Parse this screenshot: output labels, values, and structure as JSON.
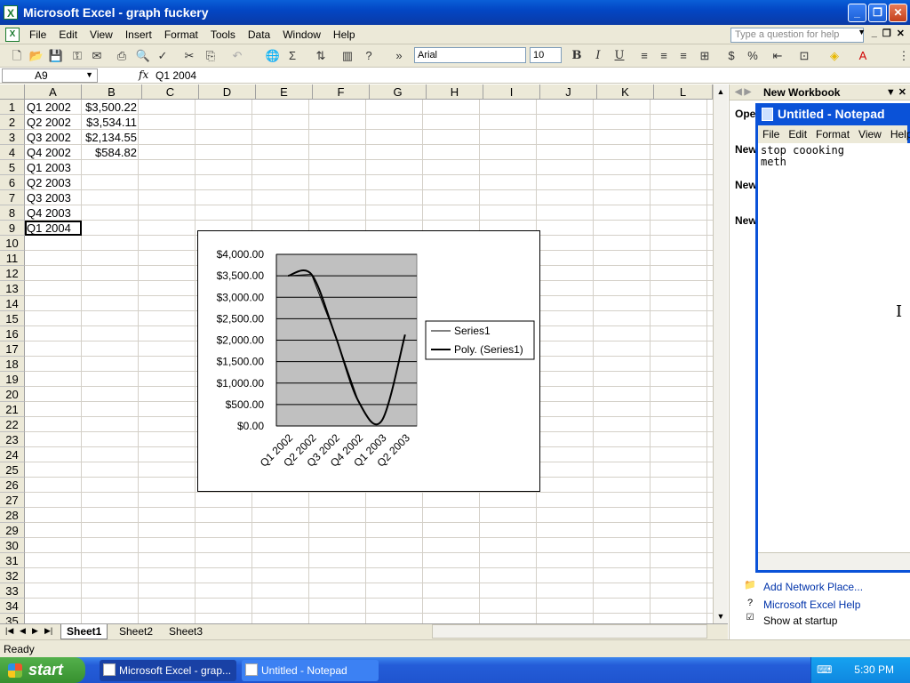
{
  "window": {
    "title": "Microsoft Excel - graph fuckery"
  },
  "menu": [
    "File",
    "Edit",
    "View",
    "Insert",
    "Format",
    "Tools",
    "Data",
    "Window",
    "Help"
  ],
  "ask_placeholder": "Type a question for help",
  "font": {
    "name": "Arial",
    "size": "10"
  },
  "formula": {
    "cell_ref": "A9",
    "fx": "fx",
    "value": "Q1 2004"
  },
  "columns": [
    "A",
    "B",
    "C",
    "D",
    "E",
    "F",
    "G",
    "H",
    "I",
    "J",
    "K",
    "L"
  ],
  "rows": [
    "1",
    "2",
    "3",
    "4",
    "5",
    "6",
    "7",
    "8",
    "9",
    "10",
    "11",
    "12",
    "13",
    "14",
    "15",
    "16",
    "17",
    "18",
    "19",
    "20",
    "21",
    "22",
    "23",
    "24",
    "25",
    "26",
    "27",
    "28",
    "29",
    "30",
    "31",
    "32",
    "33",
    "34",
    "35"
  ],
  "cells": [
    {
      "label": "Q1 2002",
      "value": "$3,500.22"
    },
    {
      "label": "Q2 2002",
      "value": "$3,534.11"
    },
    {
      "label": "Q3 2002",
      "value": "$2,134.55"
    },
    {
      "label": "Q4 2002",
      "value": "$584.82"
    },
    {
      "label": "Q1 2003",
      "value": ""
    },
    {
      "label": "Q2 2003",
      "value": ""
    },
    {
      "label": "Q3 2003",
      "value": ""
    },
    {
      "label": "Q4 2003",
      "value": ""
    },
    {
      "label": "Q1 2004",
      "value": ""
    }
  ],
  "chart_data": {
    "type": "line",
    "categories": [
      "Q1 2002",
      "Q2 2002",
      "Q3 2002",
      "Q4 2002",
      "Q1 2003",
      "Q2 2003"
    ],
    "series": [
      {
        "name": "Series1",
        "values": [
          3500.22,
          3534.11,
          2134.55,
          584.82,
          null,
          null
        ]
      },
      {
        "name": "Poly. (Series1)",
        "values": [
          3500,
          3534,
          2135,
          585,
          120,
          2130
        ]
      }
    ],
    "y_ticks": [
      "$4,000.00",
      "$3,500.00",
      "$3,000.00",
      "$2,500.00",
      "$2,000.00",
      "$1,500.00",
      "$1,000.00",
      "$500.00",
      "$0.00"
    ],
    "ylim": [
      0,
      4000
    ],
    "plot_background": "#c0c0c0",
    "grid": true,
    "legend_position": "right"
  },
  "sheet_tabs": [
    "Sheet1",
    "Sheet2",
    "Sheet3"
  ],
  "status": "Ready",
  "taskpane": {
    "title": "New Workbook",
    "sections": [
      "Ope",
      "New",
      "New",
      "New"
    ],
    "links": [
      "Add Network Place...",
      "Microsoft Excel Help"
    ],
    "show_startup": "Show at startup"
  },
  "notepad": {
    "title": "Untitled - Notepad",
    "menu": [
      "File",
      "Edit",
      "Format",
      "View",
      "Help"
    ],
    "text": "stop coooking\nmeth"
  },
  "taskbar": {
    "start": "start",
    "tasks": [
      "Microsoft Excel - grap...",
      "Untitled - Notepad"
    ],
    "time": "5:30 PM"
  }
}
